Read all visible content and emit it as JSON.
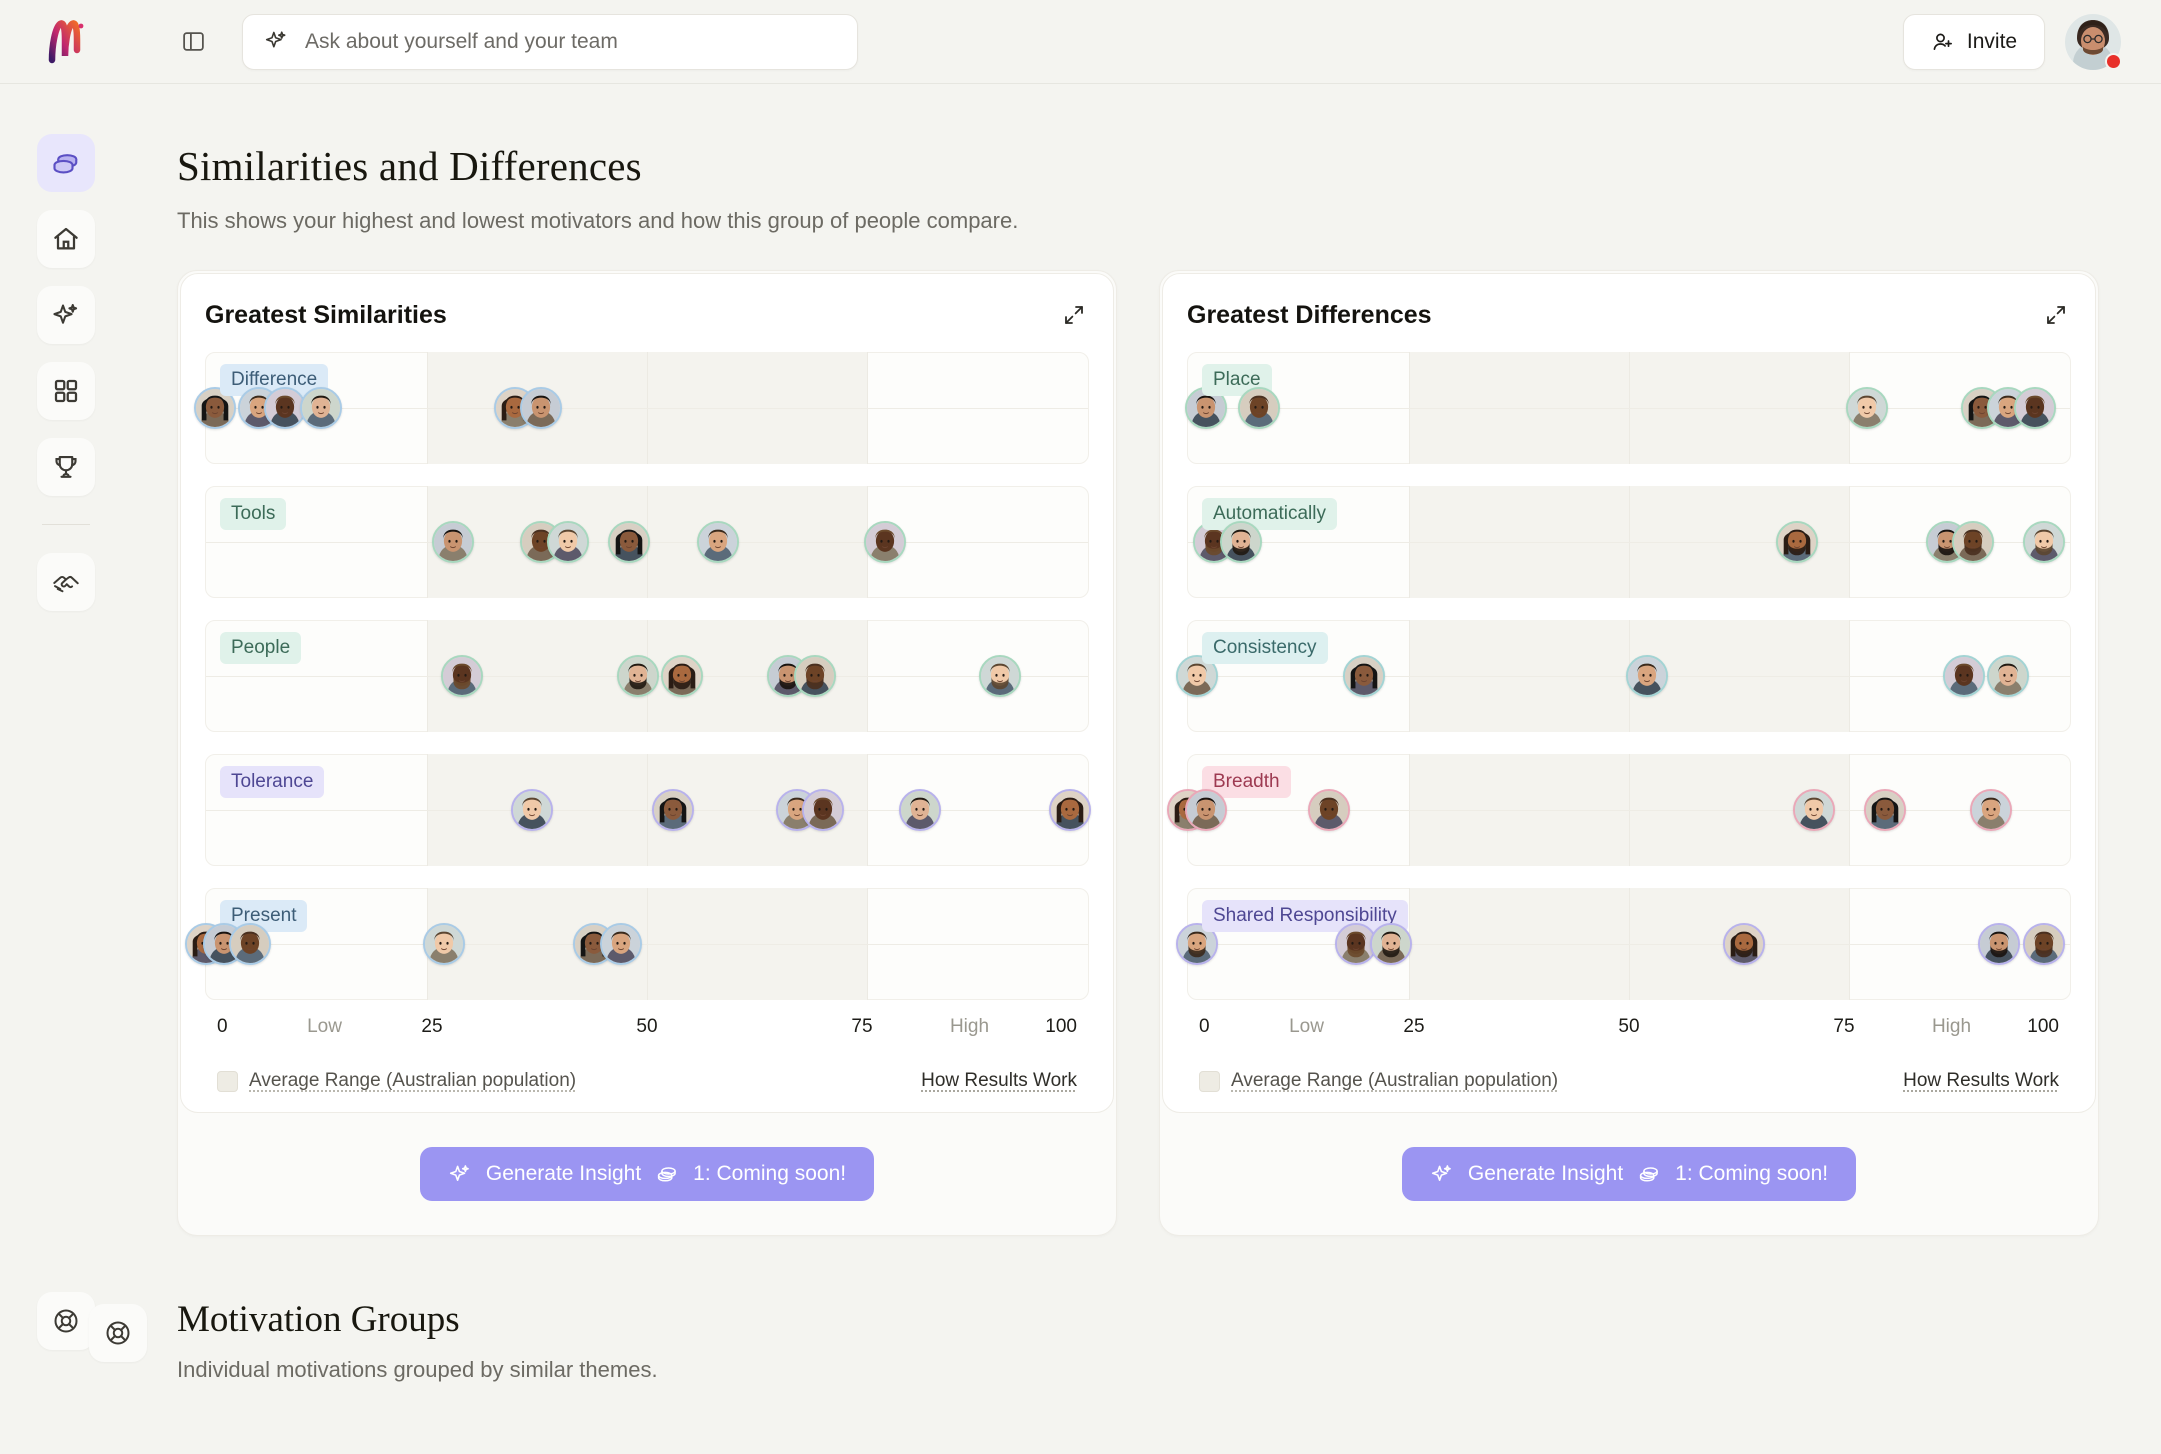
{
  "header": {
    "logo_name": "monday-m-logo",
    "panel_toggle_icon": "sidebar-panel-icon",
    "search": {
      "icon": "sparkle-icon",
      "placeholder": "Ask about yourself and your team",
      "value": ""
    },
    "invite_label": "Invite",
    "invite_icon": "person-plus-icon",
    "avatar_name": "user-avatar",
    "notification": true
  },
  "sidebar": {
    "items": [
      {
        "icon": "coins-icon",
        "name": "sidebar-item-coins",
        "active": true
      },
      {
        "icon": "home-icon",
        "name": "sidebar-item-home",
        "active": false
      },
      {
        "icon": "sparkle-icon",
        "name": "sidebar-item-insights",
        "active": false
      },
      {
        "icon": "grid-icon",
        "name": "sidebar-item-dashboard",
        "active": false
      },
      {
        "icon": "trophy-icon",
        "name": "sidebar-item-achievements",
        "active": false
      }
    ],
    "bottom_item": {
      "icon": "handshake-icon",
      "name": "sidebar-item-team"
    },
    "support_item": {
      "icon": "lifebuoy-icon",
      "name": "sidebar-item-support"
    }
  },
  "page": {
    "title": "Similarities and Differences",
    "subtitle": "This shows your highest and lowest motivators and how this group of people compare."
  },
  "axis": {
    "ticks": [
      {
        "label": "0",
        "value": 0,
        "soft": false
      },
      {
        "label": "Low",
        "value": 12.5,
        "soft": true
      },
      {
        "label": "25",
        "value": 25,
        "soft": false
      },
      {
        "label": "50",
        "value": 50,
        "soft": false
      },
      {
        "label": "75",
        "value": 75,
        "soft": false
      },
      {
        "label": "High",
        "value": 87.5,
        "soft": true
      },
      {
        "label": "100",
        "value": 100,
        "soft": false
      }
    ],
    "legend_label": "Average Range (Australian population)",
    "how_results_label": "How Results Work"
  },
  "generate_button": {
    "icon": "sparkle-icon",
    "label": "Generate Insight",
    "coin_icon": "coins-icon",
    "credits_label": "1: Coming soon!"
  },
  "bottom_section": {
    "icon": "lifebuoy-icon",
    "title": "Motivation Groups",
    "subtitle": "Individual motivations grouped by similar themes."
  },
  "chart_data": [
    {
      "type": "scatter",
      "title": "Greatest Similarities",
      "expand_icon": "expand-diagonal-icon",
      "xlabel": "",
      "ylabel": "",
      "xlim": [
        0,
        100
      ],
      "grid": true,
      "legend_position": "bottom-left",
      "band_label": "Average Range (Australian population)",
      "rows": [
        {
          "label": "Difference",
          "color": "blue",
          "band": [
            25,
            75
          ],
          "points": [
            1,
            6,
            9,
            13,
            35,
            38
          ]
        },
        {
          "label": "Tools",
          "color": "green",
          "band": [
            25,
            75
          ],
          "points": [
            28,
            38,
            41,
            48,
            58,
            77
          ]
        },
        {
          "label": "People",
          "color": "green",
          "band": [
            25,
            75
          ],
          "points": [
            29,
            49,
            54,
            66,
            69,
            90
          ]
        },
        {
          "label": "Tolerance",
          "color": "purple",
          "band": [
            25,
            75
          ],
          "points": [
            37,
            53,
            67,
            70,
            81,
            98
          ]
        },
        {
          "label": "Present",
          "color": "blue",
          "band": [
            25,
            75
          ],
          "points": [
            0,
            2,
            5,
            27,
            44,
            47
          ]
        }
      ]
    },
    {
      "type": "scatter",
      "title": "Greatest Differences",
      "expand_icon": "expand-diagonal-icon",
      "xlabel": "",
      "ylabel": "",
      "xlim": [
        0,
        100
      ],
      "grid": true,
      "legend_position": "bottom-left",
      "band_label": "Average Range (Australian population)",
      "rows": [
        {
          "label": "Place",
          "color": "green",
          "band": [
            25,
            75
          ],
          "points": [
            2,
            8,
            77,
            90,
            93,
            96
          ]
        },
        {
          "label": "Automatically",
          "color": "green",
          "band": [
            25,
            75
          ],
          "points": [
            3,
            6,
            69,
            86,
            89,
            97
          ]
        },
        {
          "label": "Consistency",
          "color": "teal",
          "band": [
            25,
            75
          ],
          "points": [
            1,
            20,
            52,
            88,
            93
          ]
        },
        {
          "label": "Breadth",
          "color": "pink",
          "band": [
            25,
            75
          ],
          "points": [
            0,
            2,
            16,
            71,
            79,
            91
          ]
        },
        {
          "label": "Shared Responsibility",
          "color": "purple",
          "band": [
            25,
            75
          ],
          "points": [
            1,
            19,
            23,
            63,
            92,
            97
          ]
        }
      ]
    }
  ]
}
